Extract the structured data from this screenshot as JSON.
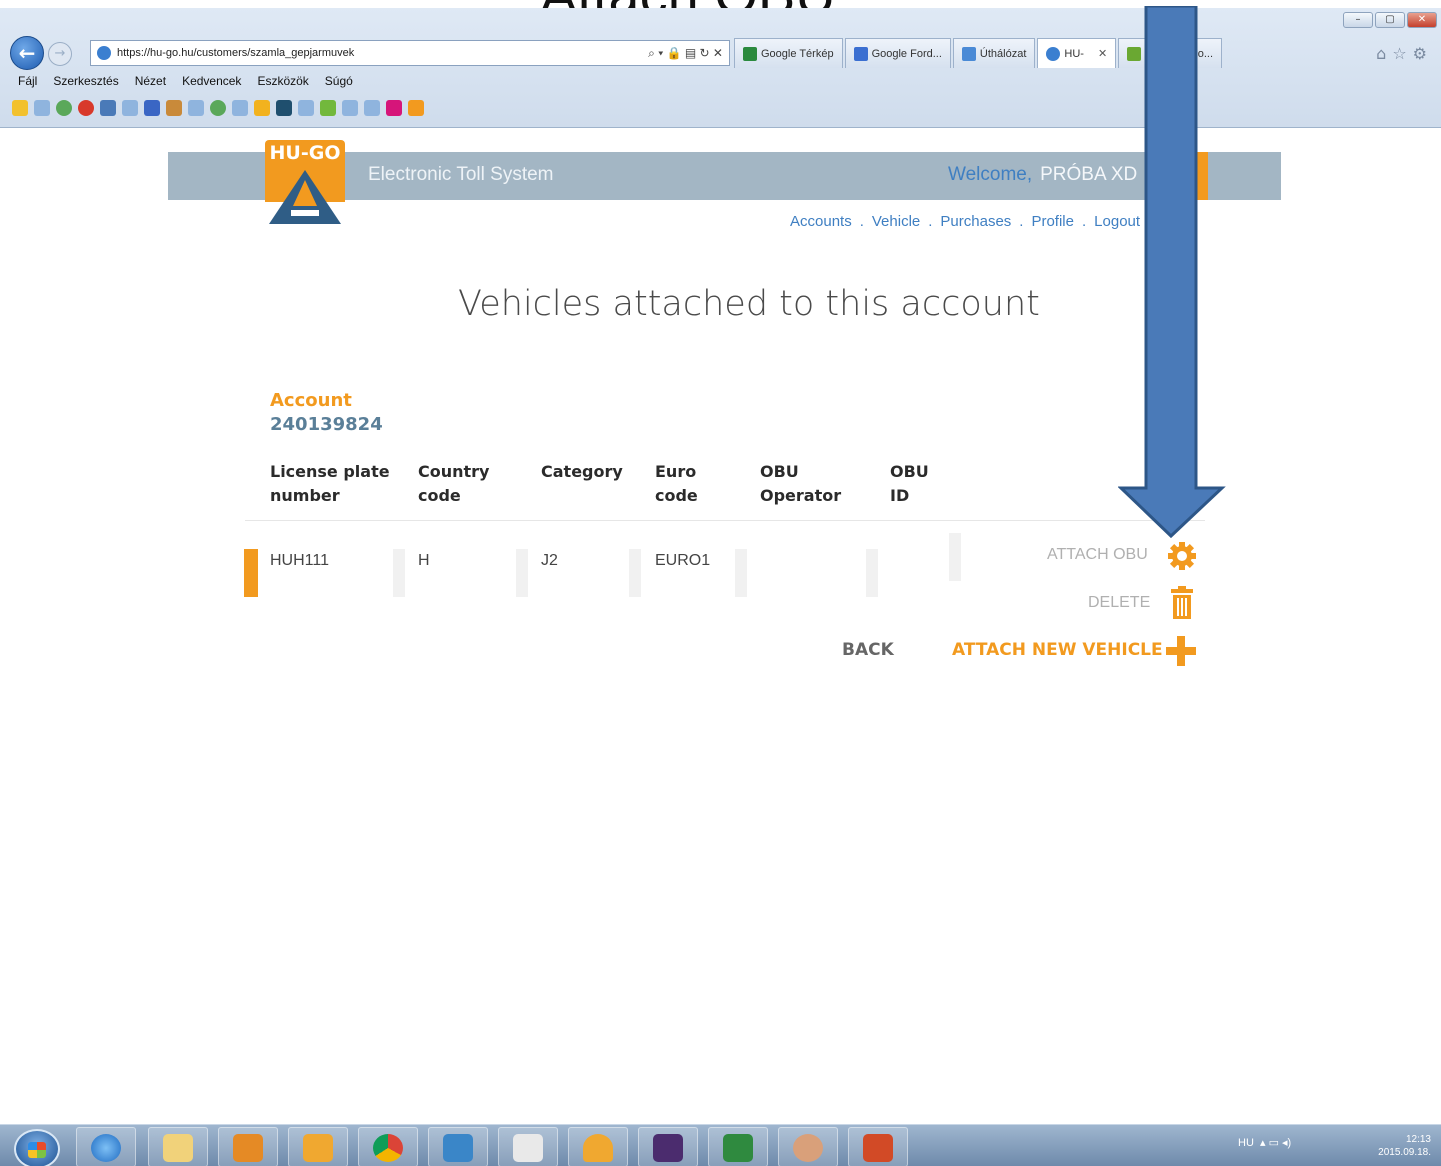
{
  "slide": {
    "title": "Attach OBU"
  },
  "browser": {
    "url": "https://hu-go.hu/customers/szamla_gepjarmuvek",
    "tabs": [
      {
        "label": "Google Térkép",
        "color": "#2b8a3e"
      },
      {
        "label": "Google Ford...",
        "color": "#3b6fd1"
      },
      {
        "label": "Úthálózat",
        "color": "#4a8ad6"
      },
      {
        "label": "HU-",
        "color": "#3b7fd0",
        "active": true
      },
      {
        "label": "Nemzeti Mo...",
        "color": "#6aa832"
      }
    ],
    "menu": [
      "Fájl",
      "Szerkesztés",
      "Nézet",
      "Kedvencek",
      "Eszközök",
      "Súgó"
    ]
  },
  "site": {
    "logo_text": "HU-GO",
    "name": "Electronic Toll System",
    "welcome_label": "Welcome,",
    "user": "PRÓBA XD",
    "nav": [
      "Accounts",
      "Vehicle",
      "Purchases",
      "Profile",
      "Logout"
    ]
  },
  "page": {
    "title": "Vehicles attached to this account",
    "account_label": "Account",
    "account_number": "240139824",
    "columns": [
      {
        "line1": "License plate",
        "line2": "number"
      },
      {
        "line1": "Country",
        "line2": "code"
      },
      {
        "line1": "Category",
        "line2": ""
      },
      {
        "line1": "Euro",
        "line2": "code"
      },
      {
        "line1": "OBU",
        "line2": "Operator"
      },
      {
        "line1": "OBU",
        "line2": "ID"
      }
    ],
    "rows": [
      {
        "plate": "HUH111",
        "country": "H",
        "category": "J2",
        "euro": "EURO1",
        "operator": "",
        "obu_id": ""
      }
    ],
    "actions": {
      "attach_obu": "ATTACH OBU",
      "delete": "DELETE",
      "back": "BACK",
      "attach_new": "ATTACH NEW VEHICLE"
    }
  },
  "taskbar": {
    "lang": "HU",
    "time": "12:13",
    "date": "2015.09.18."
  },
  "colors": {
    "accent": "#f29a1f",
    "link": "#3f7fc2",
    "band": "#a3b6c4",
    "arrow": "#4a7ab8"
  }
}
